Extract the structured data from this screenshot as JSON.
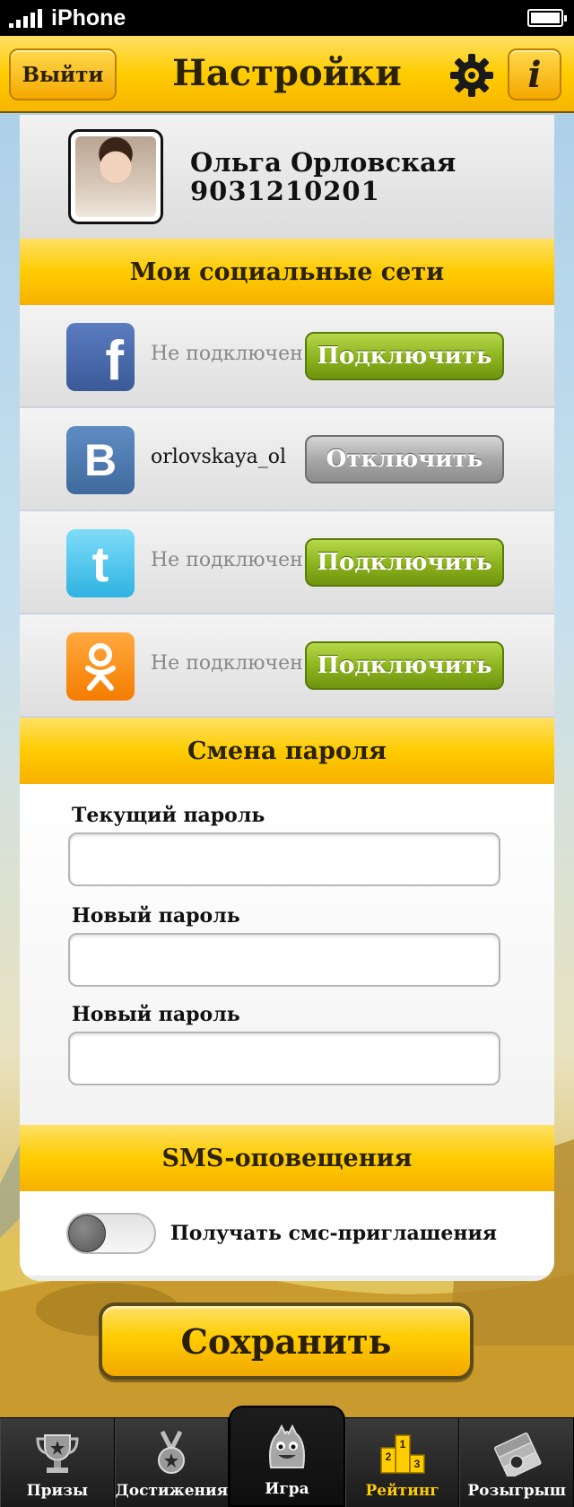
{
  "status_bar": {
    "carrier": "iPhone"
  },
  "nav": {
    "logout_label": "Выйти",
    "title": "Настройки",
    "info_label": "i"
  },
  "profile": {
    "name": "Ольга Орловская",
    "phone": "9031210201"
  },
  "social": {
    "header": "Мои социальные сети",
    "rows": [
      {
        "network": "facebook",
        "icon_glyph": "f",
        "status": "Не подключен",
        "button": "Подключить",
        "connected": false
      },
      {
        "network": "vkontakte",
        "icon_glyph": "B",
        "status": "orlovskaya_ol",
        "button": "Отключить",
        "connected": true
      },
      {
        "network": "twitter",
        "icon_glyph": "t",
        "status": "Не подключен",
        "button": "Подключить",
        "connected": false
      },
      {
        "network": "odnoklassniki",
        "icon_glyph": "ok",
        "status": "Не подключен",
        "button": "Подключить",
        "connected": false
      }
    ]
  },
  "password": {
    "header": "Смена пароля",
    "current_label": "Текущий пароль",
    "new_label": "Новый пароль",
    "repeat_label": "Новый пароль",
    "current_value": "",
    "new_value": "",
    "repeat_value": ""
  },
  "sms": {
    "header": "SMS-оповещения",
    "toggle_label": "Получать смс-приглашения",
    "enabled": false
  },
  "save_label": "Сохранить",
  "tabs": [
    {
      "label": "Призы",
      "icon": "trophy-icon",
      "active": false
    },
    {
      "label": "Достижения",
      "icon": "medal-icon",
      "active": false
    },
    {
      "label": "Игра",
      "icon": "mascot-icon",
      "active": false
    },
    {
      "label": "Рейтинг",
      "icon": "podium-icon",
      "active": true
    },
    {
      "label": "Розыгрыш",
      "icon": "tickets-icon",
      "active": false
    }
  ],
  "colors": {
    "accent_yellow": "#ffcc00",
    "connect_green": "#8fb520",
    "disconnect_gray": "#a8a8a8",
    "facebook": "#3b5998",
    "vkontakte": "#4a76a8",
    "twitter": "#3fc1ea",
    "odnoklassniki": "#f7931e"
  }
}
